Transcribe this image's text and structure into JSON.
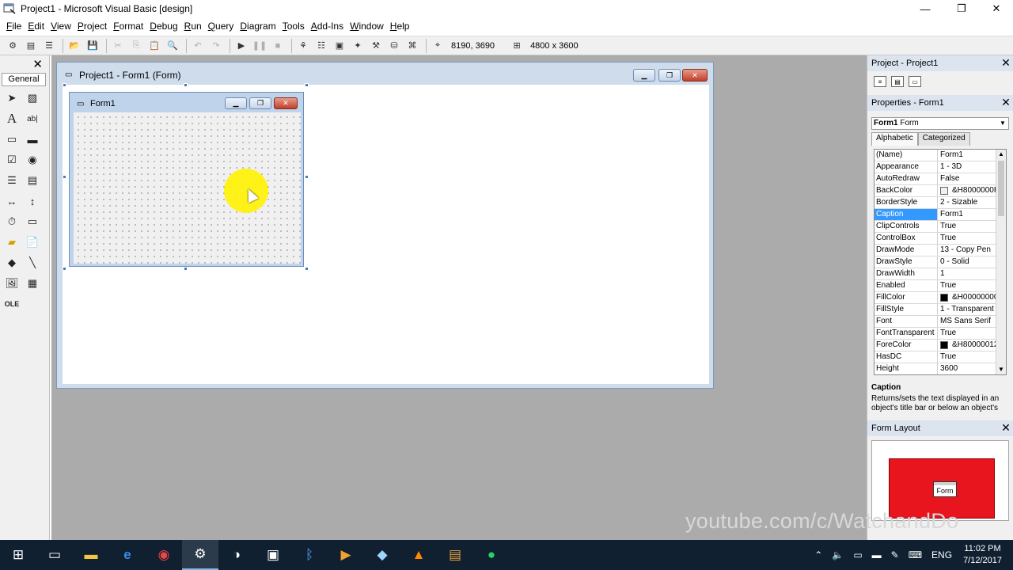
{
  "window": {
    "title": "Project1 - Microsoft Visual Basic [design]",
    "minimize": "—",
    "restore": "❐",
    "close": "✕"
  },
  "menu": [
    "File",
    "Edit",
    "View",
    "Project",
    "Format",
    "Debug",
    "Run",
    "Query",
    "Diagram",
    "Tools",
    "Add-Ins",
    "Window",
    "Help"
  ],
  "toolbar": {
    "position": "8190, 3690",
    "size": "4800 x 3600"
  },
  "toolbox": {
    "tab_label": "General",
    "close": "✕"
  },
  "project_window": {
    "title": "Project1 - Form1 (Form)"
  },
  "form1": {
    "title": "Form1"
  },
  "project_explorer": {
    "title": "Project - Project1",
    "close": "✕"
  },
  "properties": {
    "title": "Properties - Form1",
    "close": "✕",
    "object_name": "Form1",
    "object_type": "Form",
    "tabs": [
      "Alphabetic",
      "Categorized"
    ],
    "rows": [
      {
        "name": "(Name)",
        "value": "Form1"
      },
      {
        "name": "Appearance",
        "value": "1 - 3D"
      },
      {
        "name": "AutoRedraw",
        "value": "False"
      },
      {
        "name": "BackColor",
        "value": "&H8000000F",
        "swatch": "#f0f0f0"
      },
      {
        "name": "BorderStyle",
        "value": "2 - Sizable"
      },
      {
        "name": "Caption",
        "value": "Form1"
      },
      {
        "name": "ClipControls",
        "value": "True"
      },
      {
        "name": "ControlBox",
        "value": "True"
      },
      {
        "name": "DrawMode",
        "value": "13 - Copy Pen"
      },
      {
        "name": "DrawStyle",
        "value": "0 - Solid"
      },
      {
        "name": "DrawWidth",
        "value": "1"
      },
      {
        "name": "Enabled",
        "value": "True"
      },
      {
        "name": "FillColor",
        "value": "&H00000000",
        "swatch": "#000000"
      },
      {
        "name": "FillStyle",
        "value": "1 - Transparent"
      },
      {
        "name": "Font",
        "value": "MS Sans Serif"
      },
      {
        "name": "FontTransparent",
        "value": "True"
      },
      {
        "name": "ForeColor",
        "value": "&H80000012",
        "swatch": "#000000"
      },
      {
        "name": "HasDC",
        "value": "True"
      },
      {
        "name": "Height",
        "value": "3600"
      }
    ],
    "selected": "Caption",
    "description_title": "Caption",
    "description_text": "Returns/sets the text displayed in an object's title bar or below an object's"
  },
  "form_layout": {
    "title": "Form Layout",
    "close": "✕",
    "mini_form_label": "Form"
  },
  "watermark": "youtube.com/c/WatchandDo",
  "taskbar": {
    "language": "ENG",
    "time": "11:02 PM",
    "date": "7/12/2017"
  },
  "colors": {
    "selection": "#3399ff",
    "layout_screen": "#e8141e",
    "taskbar": "#102030"
  }
}
